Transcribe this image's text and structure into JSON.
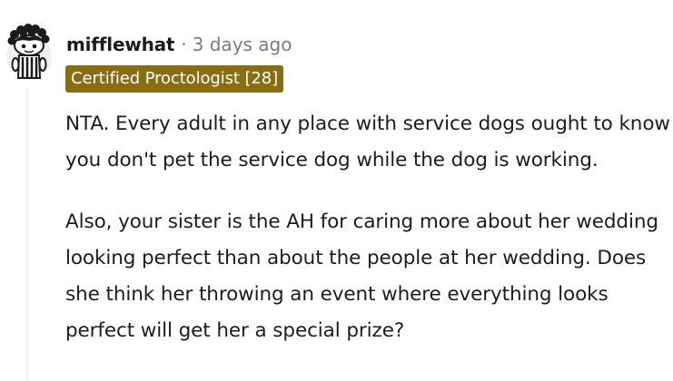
{
  "comment": {
    "username": "mifflewhat",
    "separator": "·",
    "timestamp": "3 days ago",
    "flair": "Certified Proctologist [28]",
    "paragraphs": [
      "NTA. Every adult in any place with service dogs ought to know you don't pet the service dog while the dog is working.",
      "Also, your sister is the AH for caring more about her wedding looking perfect than about the people at her wedding. Does she think her throwing an event where everything looks perfect will get her a special prize?"
    ]
  },
  "colors": {
    "flair_background": "#886d13",
    "flair_text": "#ffffff",
    "username": "#1c1c1c",
    "meta_gray": "#7c7c7c",
    "thread_line": "#edeff1"
  },
  "icons": {
    "avatar": "snoo-avatar-icon"
  }
}
